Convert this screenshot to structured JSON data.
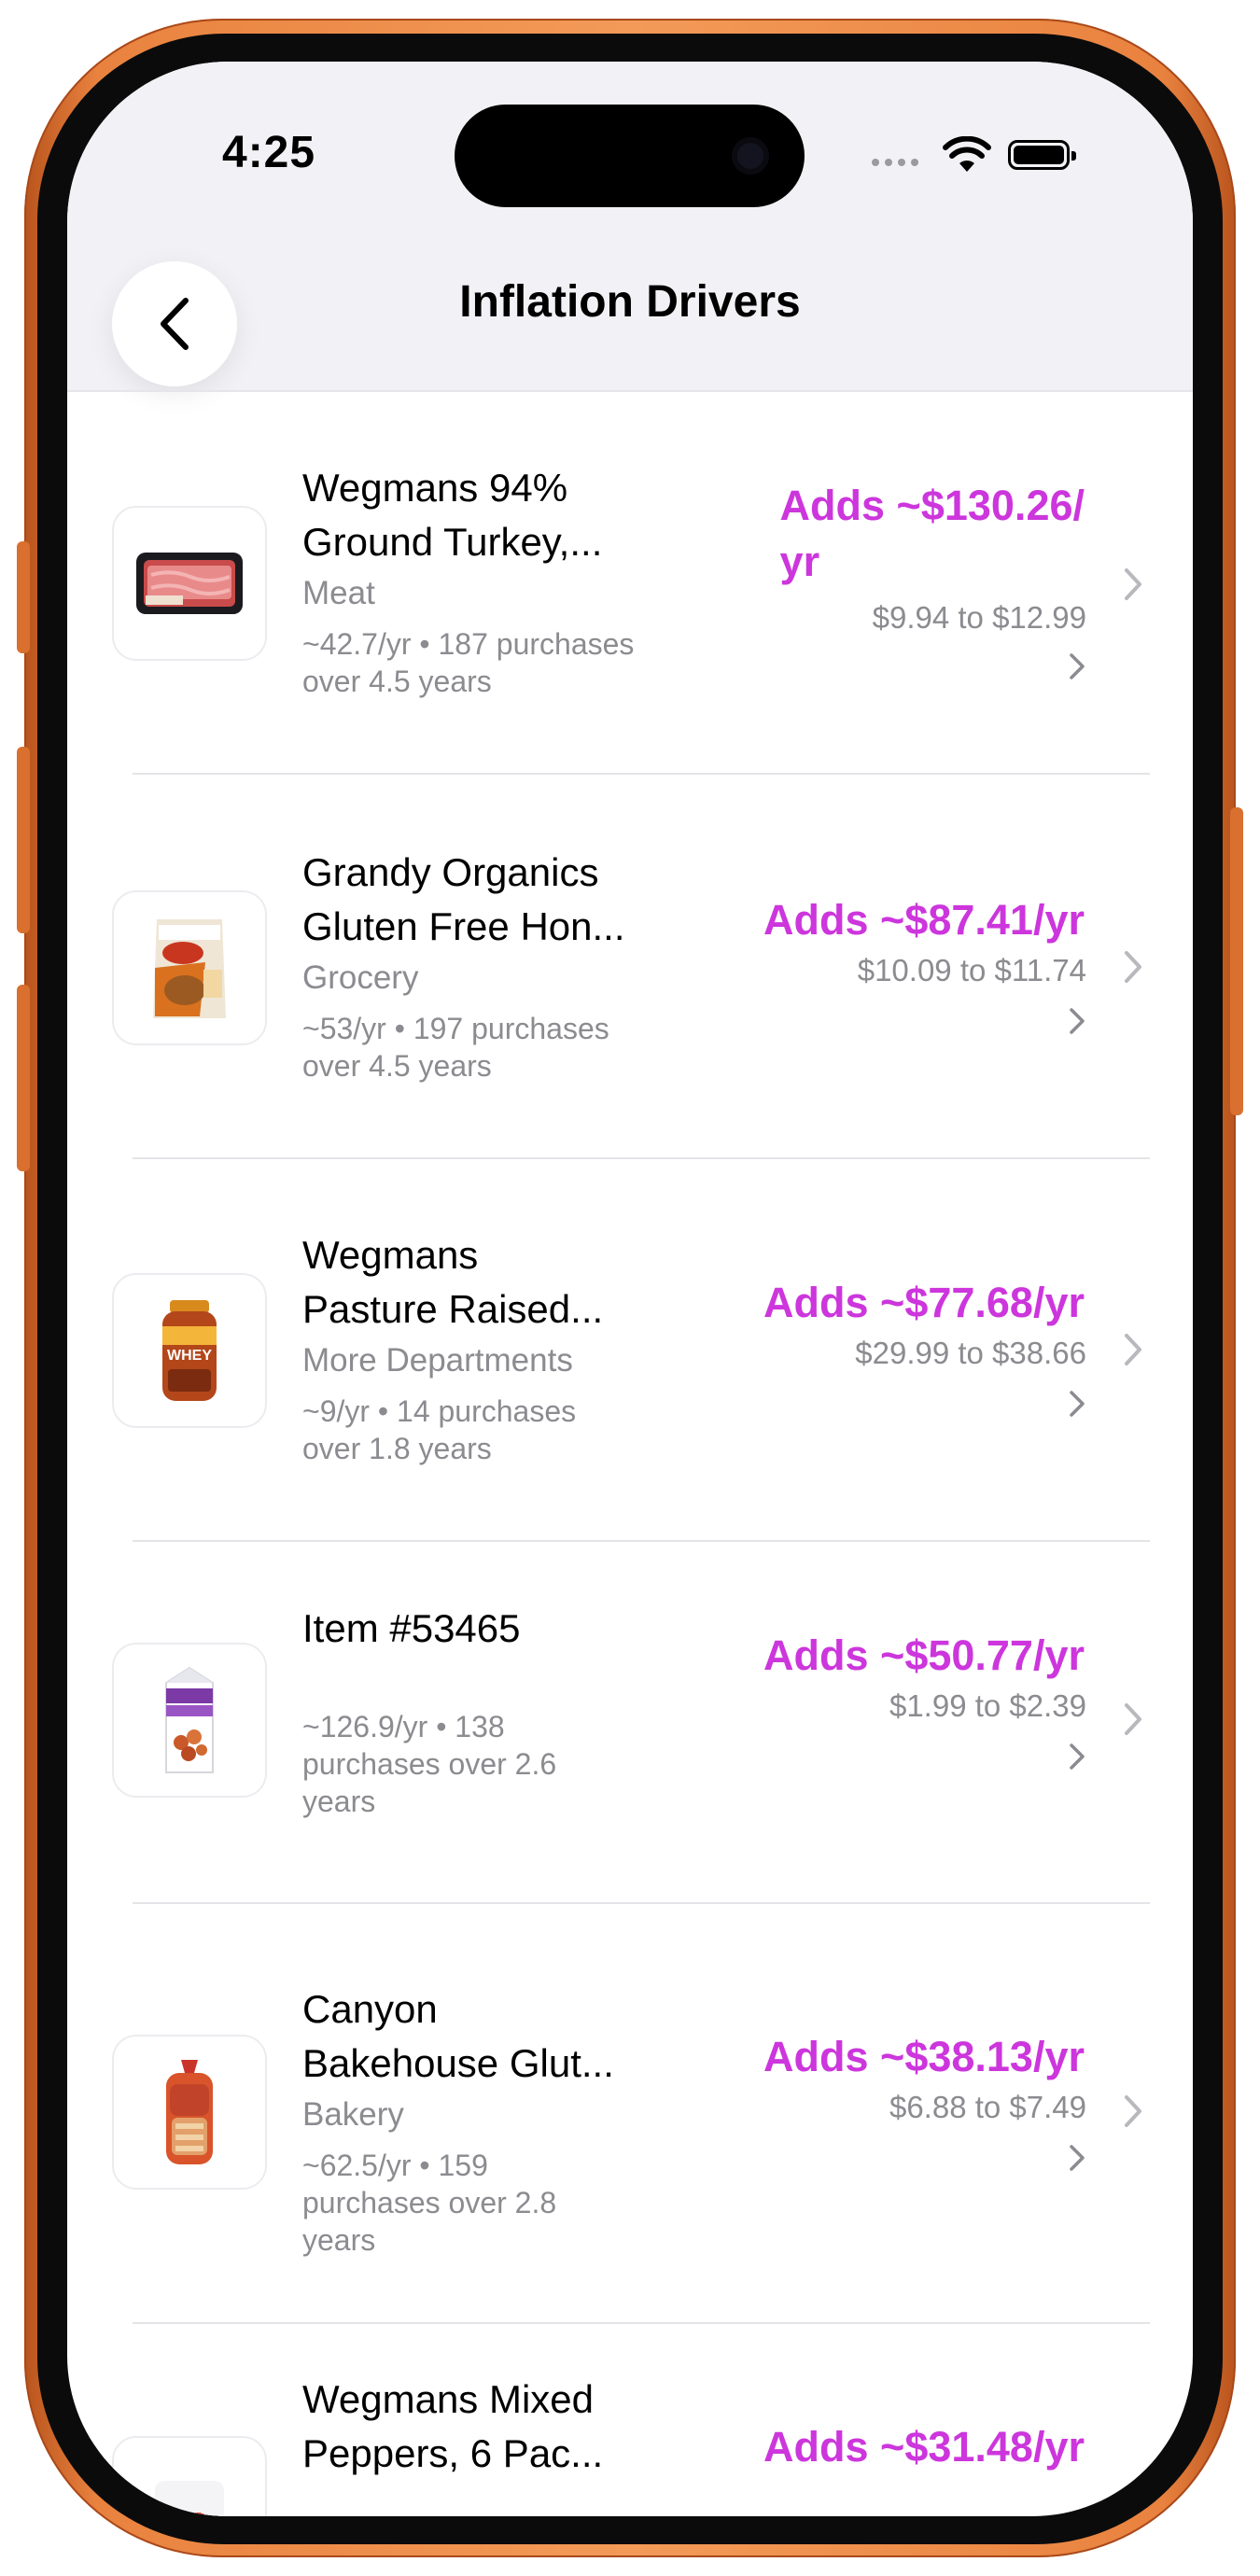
{
  "status": {
    "time": "4:25"
  },
  "header": {
    "title": "Inflation Drivers",
    "back_icon": "chevron-left-icon"
  },
  "colors": {
    "accent": "#CC36DC",
    "secondary_text": "#8B8B90",
    "frame": "#E9823F"
  },
  "items": [
    {
      "name_line1": "Wegmans 94%",
      "name_line2": "Ground Turkey,...",
      "category": "Meat",
      "stats_line1": "~42.7/yr • 187 purchases",
      "stats_line2": "over 4.5 years",
      "stats_line3": "",
      "adds_line1": "Adds ~$130.26/",
      "adds_line2": "yr",
      "range": "$9.94 to $12.99",
      "image": "ground-turkey-package"
    },
    {
      "name_line1": "Grandy Organics",
      "name_line2": "Gluten Free Hon...",
      "category": "Grocery",
      "stats_line1": "~53/yr • 197 purchases",
      "stats_line2": "over 4.5 years",
      "stats_line3": "",
      "adds_line1": "Adds ~$87.41/yr",
      "adds_line2": "",
      "range": "$10.09 to $11.74",
      "image": "granola-bag"
    },
    {
      "name_line1": "Wegmans",
      "name_line2": "Pasture Raised...",
      "category": "More Departments",
      "stats_line1": "~9/yr • 14 purchases",
      "stats_line2": "over 1.8 years",
      "stats_line3": "",
      "adds_line1": "Adds ~$77.68/yr",
      "adds_line2": "",
      "range": "$29.99 to $38.66",
      "image": "whey-tub"
    },
    {
      "name_line1": "Item #53465",
      "name_line2": "",
      "category": "",
      "stats_line1": "~126.9/yr • 138",
      "stats_line2": "purchases over 2.6",
      "stats_line3": "years",
      "adds_line1": "Adds ~$50.77/yr",
      "adds_line2": "",
      "range": "$1.99 to $2.39",
      "image": "almond-milk-carton"
    },
    {
      "name_line1": "Canyon",
      "name_line2": "Bakehouse Glut...",
      "category": "Bakery",
      "stats_line1": "~62.5/yr • 159",
      "stats_line2": "purchases over 2.8",
      "stats_line3": "years",
      "adds_line1": "Adds ~$38.13/yr",
      "adds_line2": "",
      "range": "$6.88 to $7.49",
      "image": "bread-bag"
    },
    {
      "name_line1": "Wegmans Mixed",
      "name_line2": "Peppers, 6 Pac...",
      "category": "",
      "stats_line1": "",
      "stats_line2": "",
      "stats_line3": "",
      "adds_line1": "Adds ~$31.48/yr",
      "adds_line2": "",
      "range": "",
      "image": "peppers-bag"
    }
  ]
}
